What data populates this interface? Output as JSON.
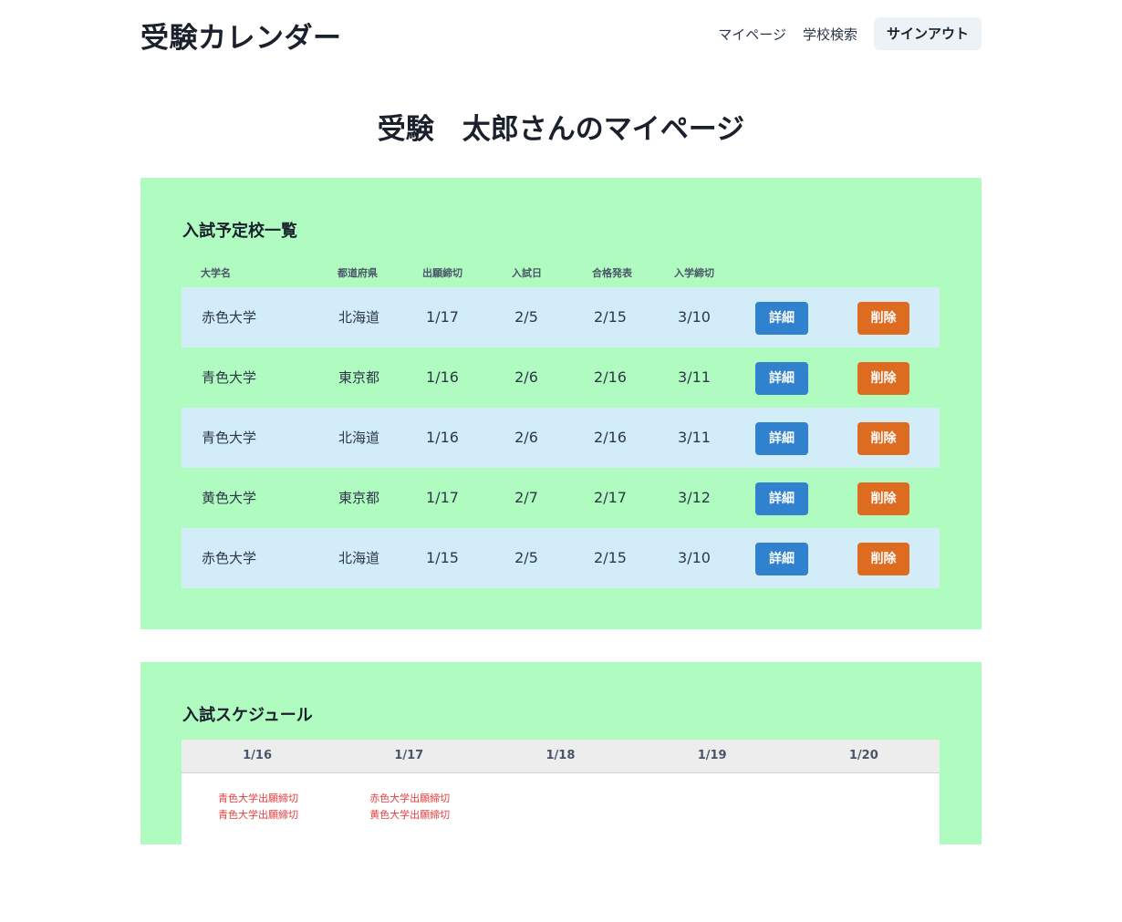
{
  "app": {
    "logo": "受験カレンダー",
    "nav": {
      "mypage": "マイページ",
      "search": "学校検索",
      "signout": "サインアウト"
    }
  },
  "page_title": "受験　太郎さんのマイページ",
  "schools": {
    "heading": "入試予定校一覧",
    "columns": [
      "大学名",
      "都道府県",
      "出願締切",
      "入試日",
      "合格発表",
      "入学締切"
    ],
    "detail_label": "詳細",
    "delete_label": "削除",
    "rows": [
      {
        "name": "赤色大学",
        "pref": "北海道",
        "deadline": "1/17",
        "exam": "2/5",
        "result": "2/15",
        "enroll": "3/10"
      },
      {
        "name": "青色大学",
        "pref": "東京都",
        "deadline": "1/16",
        "exam": "2/6",
        "result": "2/16",
        "enroll": "3/11"
      },
      {
        "name": "青色大学",
        "pref": "北海道",
        "deadline": "1/16",
        "exam": "2/6",
        "result": "2/16",
        "enroll": "3/11"
      },
      {
        "name": "黄色大学",
        "pref": "東京都",
        "deadline": "1/17",
        "exam": "2/7",
        "result": "2/17",
        "enroll": "3/12"
      },
      {
        "name": "赤色大学",
        "pref": "北海道",
        "deadline": "1/15",
        "exam": "2/5",
        "result": "2/15",
        "enroll": "3/10"
      }
    ]
  },
  "schedule": {
    "heading": "入試スケジュール",
    "days": [
      "1/16",
      "1/17",
      "1/18",
      "1/19",
      "1/20"
    ],
    "events": [
      [
        "青色大学出願締切",
        "青色大学出願締切"
      ],
      [
        "赤色大学出願締切",
        "黄色大学出願締切"
      ],
      [],
      [],
      []
    ]
  },
  "colors": {
    "panel_bg": "#b0fcc0",
    "row_alt": "#d2ecf8",
    "detail_button": "#3182ce",
    "delete_button": "#dd6b20",
    "event_text": "#e53e3e"
  }
}
